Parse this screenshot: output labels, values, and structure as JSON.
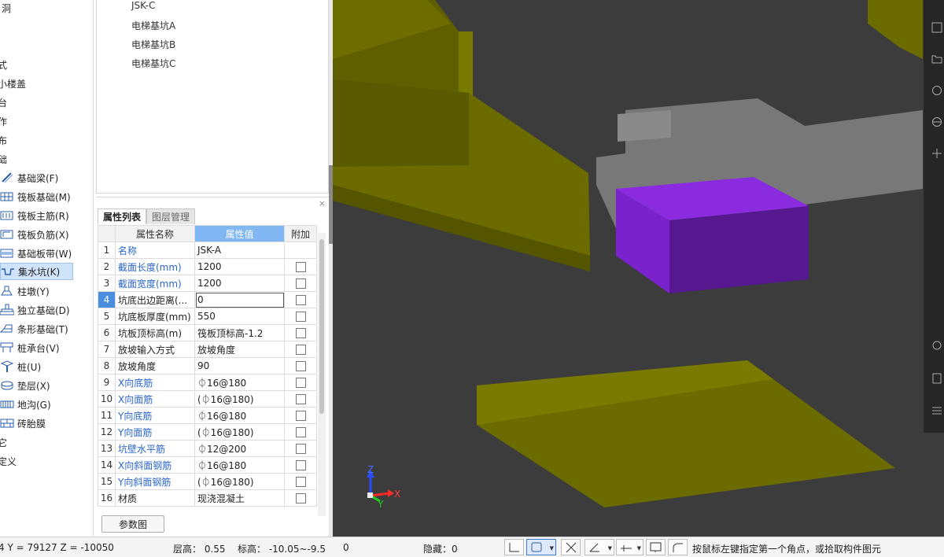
{
  "left_nav": {
    "cut_labels": [
      "洞",
      "式",
      "小楼盖",
      "台",
      "作",
      "布",
      "础",
      "它",
      "定义"
    ],
    "items": [
      {
        "label": "基础梁(F)",
        "icon": "beam-icon"
      },
      {
        "label": "筏板基础(M)",
        "icon": "raft-foundation-icon"
      },
      {
        "label": "筏板主筋(R)",
        "icon": "raft-main-rebar-icon"
      },
      {
        "label": "筏板负筋(X)",
        "icon": "raft-negative-rebar-icon"
      },
      {
        "label": "基础板带(W)",
        "icon": "foundation-strip-icon"
      },
      {
        "label": "集水坑(K)",
        "icon": "sump-pit-icon",
        "selected": true
      },
      {
        "label": "柱墩(Y)",
        "icon": "column-pier-icon"
      },
      {
        "label": "独立基础(D)",
        "icon": "isolated-footing-icon"
      },
      {
        "label": "条形基础(T)",
        "icon": "strip-footing-icon"
      },
      {
        "label": "桩承台(V)",
        "icon": "pile-cap-icon"
      },
      {
        "label": "桩(U)",
        "icon": "pile-icon"
      },
      {
        "label": "垫层(X)",
        "icon": "cushion-layer-icon"
      },
      {
        "label": "地沟(G)",
        "icon": "trench-icon"
      },
      {
        "label": "砖胎膜",
        "icon": "brick-membrane-icon"
      }
    ]
  },
  "component_list": [
    "JSK-C",
    "电梯基坑A",
    "电梯基坑B",
    "电梯基坑C"
  ],
  "property_panel": {
    "close": "×",
    "tabs": [
      {
        "label": "属性列表",
        "active": true
      },
      {
        "label": "图层管理",
        "active": false
      }
    ],
    "headers": {
      "name": "属性名称",
      "value": "属性值",
      "extra": "附加"
    },
    "rows": [
      {
        "n": "1",
        "name": "名称",
        "value": "JSK-A",
        "blue": true,
        "checkbox": false
      },
      {
        "n": "2",
        "name": "截面长度(mm)",
        "value": "1200",
        "blue": true,
        "checkbox": true
      },
      {
        "n": "3",
        "name": "截面宽度(mm)",
        "value": "1200",
        "blue": true,
        "checkbox": true
      },
      {
        "n": "4",
        "name": "坑底出边距离(...",
        "value": "0",
        "blue": false,
        "checkbox": true,
        "selected": true
      },
      {
        "n": "5",
        "name": "坑底板厚度(mm)",
        "value": "550",
        "blue": false,
        "checkbox": true
      },
      {
        "n": "6",
        "name": "坑板顶标高(m)",
        "value": "筏板顶标高-1.2",
        "blue": false,
        "checkbox": true
      },
      {
        "n": "7",
        "name": "放坡输入方式",
        "value": "放坡角度",
        "blue": false,
        "checkbox": true
      },
      {
        "n": "8",
        "name": "放坡角度",
        "value": "90",
        "blue": false,
        "checkbox": true
      },
      {
        "n": "9",
        "name": "X向底筋",
        "value": "⏀16@180",
        "blue": true,
        "checkbox": true
      },
      {
        "n": "10",
        "name": "X向面筋",
        "value": "(⏀16@180)",
        "blue": true,
        "checkbox": true
      },
      {
        "n": "11",
        "name": "Y向底筋",
        "value": "⏀16@180",
        "blue": true,
        "checkbox": true
      },
      {
        "n": "12",
        "name": "Y向面筋",
        "value": "(⏀16@180)",
        "blue": true,
        "checkbox": true
      },
      {
        "n": "13",
        "name": "坑壁水平筋",
        "value": "⏀12@200",
        "blue": true,
        "checkbox": true
      },
      {
        "n": "14",
        "name": "X向斜面钢筋",
        "value": "⏀16@180",
        "blue": true,
        "checkbox": true
      },
      {
        "n": "15",
        "name": "Y向斜面钢筋",
        "value": "(⏀16@180)",
        "blue": true,
        "checkbox": true
      },
      {
        "n": "16",
        "name": "材质",
        "value": "现浇混凝土",
        "blue": false,
        "checkbox": true
      }
    ],
    "param_button": "参数图"
  },
  "viewport": {
    "axis_z": "Z",
    "axis_x": "X",
    "axis_y": "Y",
    "colors": {
      "background": "#3c3c3c",
      "beam_top": "#6e6e00",
      "beam_front": "#5a5a00",
      "pit_top": "#8b2ee0",
      "pit_front": "#6a1fb4",
      "slab": "#7a7a7a"
    }
  },
  "status_bar": {
    "coords": "4 Y = 79127 Z = -10050",
    "floor_height": "层高： 0.55",
    "elevation": "标高： -10.05~-9.5",
    "zero": "0",
    "hidden": "隐藏：0",
    "hint": "按鼠标左键指定第一个角点，或拾取构件图元"
  }
}
